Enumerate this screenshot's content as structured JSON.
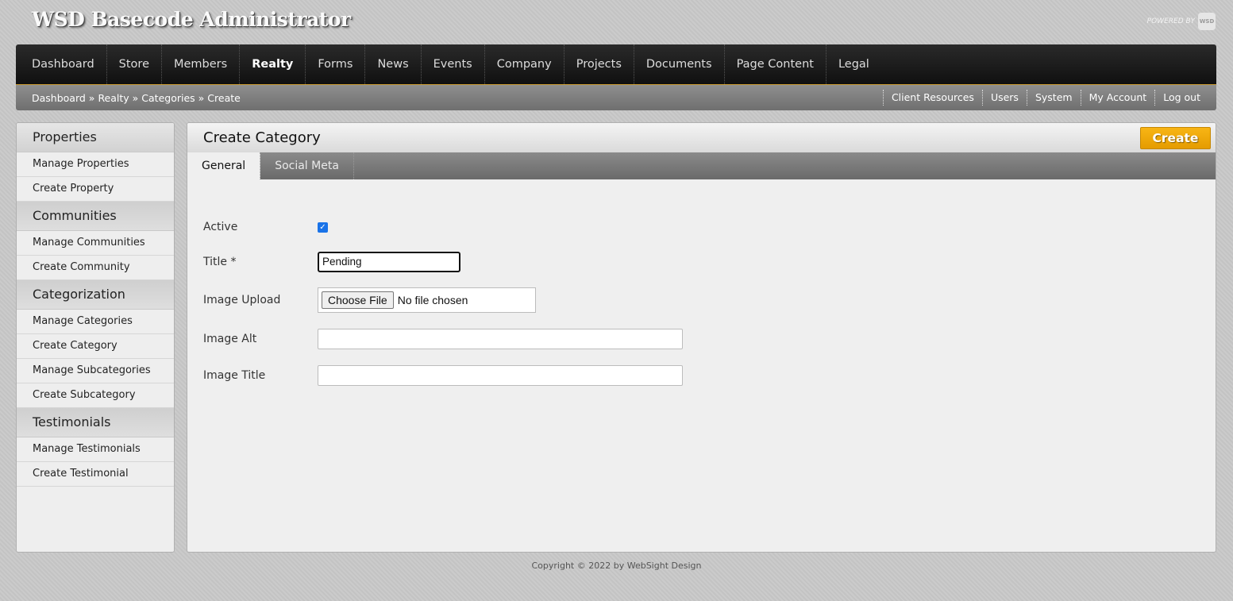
{
  "header": {
    "app_title": "WSD Basecode Administrator",
    "powered_by": "POWERED BY",
    "logo_text": "WSD"
  },
  "main_nav": [
    {
      "label": "Dashboard"
    },
    {
      "label": "Store"
    },
    {
      "label": "Members"
    },
    {
      "label": "Realty",
      "active": true
    },
    {
      "label": "Forms"
    },
    {
      "label": "News"
    },
    {
      "label": "Events"
    },
    {
      "label": "Company"
    },
    {
      "label": "Projects"
    },
    {
      "label": "Documents"
    },
    {
      "label": "Page Content"
    },
    {
      "label": "Legal"
    }
  ],
  "breadcrumb": {
    "items": [
      "Dashboard",
      "Realty",
      "Categories",
      "Create"
    ],
    "separator": " » "
  },
  "util_links": [
    "Client Resources",
    "Users",
    "System",
    "My Account",
    "Log out"
  ],
  "sidebar": {
    "sections": [
      {
        "heading": "Properties",
        "items": [
          "Manage Properties",
          "Create Property"
        ]
      },
      {
        "heading": "Communities",
        "items": [
          "Manage Communities",
          "Create Community"
        ]
      },
      {
        "heading": "Categorization",
        "items": [
          "Manage Categories",
          "Create Category",
          "Manage Subcategories",
          "Create Subcategory"
        ]
      },
      {
        "heading": "Testimonials",
        "items": [
          "Manage Testimonials",
          "Create Testimonial"
        ]
      }
    ]
  },
  "content": {
    "title": "Create Category",
    "create_button": "Create",
    "tabs": [
      {
        "label": "General",
        "active": true
      },
      {
        "label": "Social Meta"
      }
    ],
    "form": {
      "active_label": "Active",
      "active_checked": true,
      "title_label": "Title *",
      "title_value": "Pending",
      "image_upload_label": "Image Upload",
      "choose_file_label": "Choose File",
      "no_file_text": "No file chosen",
      "image_alt_label": "Image Alt",
      "image_alt_value": "",
      "image_title_label": "Image Title",
      "image_title_value": ""
    }
  },
  "footer": {
    "copyright": "Copyright © 2022 by WebSight Design"
  },
  "colors": {
    "accent": "#f0a500",
    "nav_bg": "#1a1a1a",
    "checkbox": "#1a73e8"
  }
}
